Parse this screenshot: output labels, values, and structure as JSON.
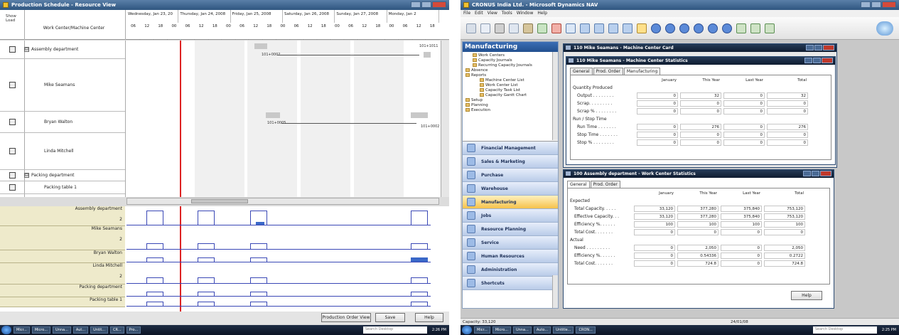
{
  "left": {
    "window_title": "Production Schedule - Resource View",
    "header": {
      "show_load": "Show Load",
      "work_center": "Work Center/Machine Center",
      "days": [
        "Wednesday, Jan 23, 20",
        "Thursday, Jan 24, 2008",
        "Friday, Jan 25, 2008",
        "Saturday, Jan 26, 2008",
        "Sunday, Jan 27, 2008",
        "Monday, Jan 2"
      ],
      "hours": [
        "06",
        "12",
        "18",
        "00",
        "06",
        "12",
        "18",
        "00",
        "06",
        "12",
        "18",
        "00",
        "06",
        "12",
        "18",
        "00",
        "06",
        "12",
        "18",
        "00",
        "06",
        "12",
        "18"
      ]
    },
    "rows": [
      {
        "label": "Assembly department",
        "expander": "⊟"
      },
      {
        "label": "Mike Seamans"
      },
      {
        "label": "Bryan Walton"
      },
      {
        "label": "Linda Mitchell"
      },
      {
        "label": "Packing department",
        "expander": "⊟"
      },
      {
        "label": "Packing table 1"
      }
    ],
    "tasks": [
      {
        "label": "101+0002"
      },
      {
        "label": "101+1011"
      },
      {
        "label": "101+0005"
      },
      {
        "label": "101+0002"
      }
    ],
    "load": [
      {
        "label": "Assembly department",
        "level": "2"
      },
      {
        "label": "Mike Seamans",
        "level": "2"
      },
      {
        "label": "Bryan Walton",
        "level": ""
      },
      {
        "label": "Linda Mitchell",
        "level": "2"
      },
      {
        "label": "Packing department",
        "level": ""
      },
      {
        "label": "Packing table 1",
        "level": ""
      }
    ],
    "buttons": {
      "order_view": "Production Order View",
      "save": "Save",
      "help": "Help"
    },
    "taskbar": {
      "items": [
        "Micr...",
        "Micro...",
        "Unna...",
        "Aut...",
        "Untit...",
        "CR...",
        "Pro..."
      ],
      "search": "Search Desktop",
      "clock": "2:26 PM"
    }
  },
  "right": {
    "window_title": "CRONUS India Ltd. - Microsoft Dynamics NAV",
    "menu": [
      "File",
      "Edit",
      "View",
      "Tools",
      "Window",
      "Help"
    ],
    "nav": {
      "title": "Manufacturing",
      "tree": [
        {
          "label": "Work Centers",
          "level": 1
        },
        {
          "label": "Capacity Journals",
          "level": 1
        },
        {
          "label": "Recurring Capacity Journals",
          "level": 1
        },
        {
          "label": "Absence",
          "level": 0
        },
        {
          "label": "Reports",
          "level": 0
        },
        {
          "label": "Machine Center List",
          "level": 2
        },
        {
          "label": "Work Center List",
          "level": 2
        },
        {
          "label": "Capacity Task List",
          "level": 2
        },
        {
          "label": "Capacity Gantt Chart",
          "level": 2
        },
        {
          "label": "Setup",
          "level": 0
        },
        {
          "label": "Planning",
          "level": 0
        },
        {
          "label": "Execution",
          "level": 0
        }
      ],
      "buttons": [
        {
          "label": "Financial Management",
          "active": false
        },
        {
          "label": "Sales & Marketing",
          "active": false
        },
        {
          "label": "Purchase",
          "active": false
        },
        {
          "label": "Warehouse",
          "active": false
        },
        {
          "label": "Manufacturing",
          "active": true
        },
        {
          "label": "Jobs",
          "active": false
        },
        {
          "label": "Resource Planning",
          "active": false
        },
        {
          "label": "Service",
          "active": false
        },
        {
          "label": "Human Resources",
          "active": false
        },
        {
          "label": "Administration",
          "active": false
        },
        {
          "label": "Shortcuts",
          "active": false
        }
      ]
    },
    "card": {
      "title": "110 Mike Seamans - Machine Center Card"
    },
    "mc_stats": {
      "title": "110 Mike Seamans - Machine Center Statistics",
      "tabs": [
        "General",
        "Prod. Order",
        "Manufacturing"
      ],
      "columns": [
        "January",
        "This Year",
        "Last Year",
        "Total"
      ],
      "sections": [
        {
          "header": "Quantity Produced",
          "rows": [
            {
              "name": "Output . . . . . . . .",
              "values": [
                "0",
                "32",
                "0",
                "32"
              ]
            },
            {
              "name": "Scrap. . . . . . . . .",
              "values": [
                "0",
                "0",
                "0",
                "0"
              ]
            },
            {
              "name": "Scrap % . . . . . . . .",
              "values": [
                "0",
                "0",
                "0",
                "0"
              ]
            }
          ]
        },
        {
          "header": "Run / Stop Time",
          "rows": [
            {
              "name": "Run Time . . . . . . .",
              "values": [
                "0",
                "276",
                "0",
                "276"
              ]
            },
            {
              "name": "Stop Time . . . . . . .",
              "values": [
                "0",
                "0",
                "0",
                "0"
              ]
            },
            {
              "name": "Stop % . . . . . . . .",
              "values": [
                "0",
                "0",
                "0",
                "0"
              ]
            }
          ]
        }
      ]
    },
    "wc_stats": {
      "title": "100 Assembly department - Work Center Statistics",
      "tabs": [
        "General",
        "Prod. Order"
      ],
      "columns": [
        "January",
        "This Year",
        "Last Year",
        "Total"
      ],
      "sections": [
        {
          "header": "Expected",
          "rows": [
            {
              "name": "Total Capacity. . . . .",
              "values": [
                "33,120",
                "377,280",
                "375,840",
                "753,120"
              ]
            },
            {
              "name": "Effective Capacity. . .",
              "values": [
                "33,120",
                "377,280",
                "375,840",
                "753,120"
              ]
            },
            {
              "name": "Efficiency %. . . . . .",
              "values": [
                "100",
                "100",
                "100",
                "100"
              ]
            },
            {
              "name": "Total Cost. . . . . . .",
              "values": [
                "0",
                "0",
                "0",
                "0"
              ]
            }
          ]
        },
        {
          "header": "Actual",
          "rows": [
            {
              "name": "Need . . . . . . . . .",
              "values": [
                "0",
                "2,050",
                "0",
                "2,050"
              ]
            },
            {
              "name": "Efficiency %. . . . . .",
              "values": [
                "0",
                "0.54336",
                "0",
                "0.2722"
              ]
            },
            {
              "name": "Total Cost. . . . . . .",
              "values": [
                "0",
                "724.8",
                "0",
                "724.8"
              ]
            }
          ]
        }
      ],
      "help": "Help"
    },
    "status": {
      "capacity": "Capacity: 33,120",
      "date": "24/01/08"
    },
    "taskbar": {
      "items": [
        "Micr...",
        "Micro...",
        "Unna...",
        "Auto...",
        "Untitle...",
        "CRON..."
      ],
      "search": "Search Desktop",
      "clock": "2:25 PM"
    }
  },
  "colors": {
    "deadline_line": "#d22222",
    "capacity_line": "#3a48b6",
    "nav_active": "#f6c24b",
    "title_gradient": "#2f5680"
  }
}
